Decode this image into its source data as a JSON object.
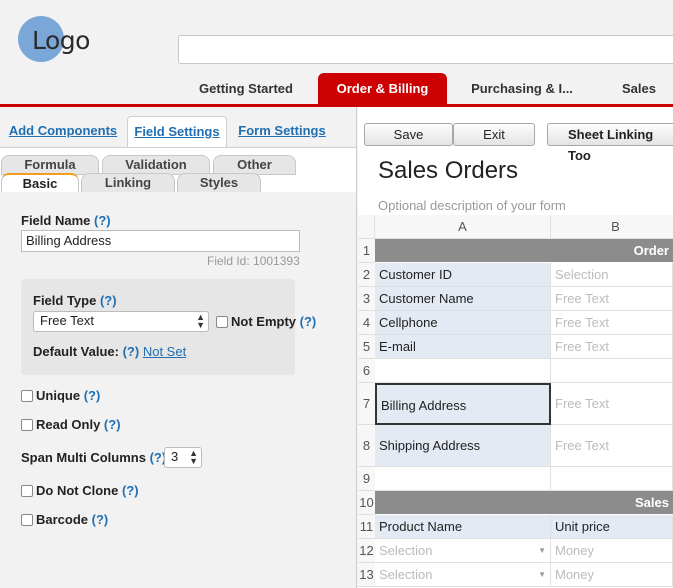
{
  "header": {
    "logo_text": "Logo",
    "tabs": [
      "Getting Started",
      "Order & Billing",
      "Purchasing & I...",
      "Sales"
    ],
    "active_tab": "Order & Billing"
  },
  "left_panel": {
    "tabs": [
      "Add Components",
      "Field Settings",
      "Form Settings"
    ],
    "active_tab": "Field Settings",
    "prop_tabs_row1": [
      "Formula",
      "Validation",
      "Other"
    ],
    "prop_tabs_row2": [
      "Basic",
      "Linking",
      "Styles"
    ],
    "active_prop_tab": "Basic",
    "field_name_label": "Field Name",
    "help": "(?)",
    "field_name_value": "Billing Address",
    "field_id": "Field Id: 1001393",
    "field_type_label": "Field Type",
    "field_type_value": "Free Text",
    "not_empty_label": "Not Empty",
    "default_value_label": "Default Value:",
    "default_value_link": "Not Set",
    "unique_label": "Unique",
    "read_only_label": "Read Only",
    "span_label": "Span Multi Columns",
    "span_value": "3",
    "do_not_clone_label": "Do Not Clone",
    "barcode_label": "Barcode"
  },
  "right_panel": {
    "buttons": [
      "Save",
      "Exit",
      "Sheet Linking Too"
    ],
    "title": "Sales Orders",
    "description": "Optional description of your form",
    "columns": [
      "A",
      "B"
    ],
    "rows": [
      {
        "num": "1",
        "a": "",
        "b": "Order",
        "type": "header"
      },
      {
        "num": "2",
        "a": "Customer ID",
        "b": "Selection",
        "type": "field"
      },
      {
        "num": "3",
        "a": "Customer Name",
        "b": "Free Text",
        "type": "field"
      },
      {
        "num": "4",
        "a": "Cellphone",
        "b": "Free Text",
        "type": "field"
      },
      {
        "num": "5",
        "a": "E-mail",
        "b": "Free Text",
        "type": "field"
      },
      {
        "num": "6",
        "a": "",
        "b": "",
        "type": "empty"
      },
      {
        "num": "7",
        "a": "Billing Address",
        "b": "Free Text",
        "type": "selected"
      },
      {
        "num": "8",
        "a": "Shipping Address",
        "b": "Free Text",
        "type": "field"
      },
      {
        "num": "9",
        "a": "",
        "b": "",
        "type": "empty"
      },
      {
        "num": "10",
        "a": "",
        "b": "Sales",
        "type": "header"
      },
      {
        "num": "11",
        "a": "Product Name",
        "b": "Unit price",
        "type": "field"
      },
      {
        "num": "12",
        "a": "Selection",
        "b": "Money",
        "type": "placeholder"
      },
      {
        "num": "13",
        "a": "Selection",
        "b": "Money",
        "type": "placeholder"
      }
    ]
  },
  "colors": {
    "accent_red": "#cc0000",
    "link_blue": "#1f6fb2",
    "label_cell_bg": "#e3eaf3",
    "section_header_bg": "#8c8c8c"
  }
}
